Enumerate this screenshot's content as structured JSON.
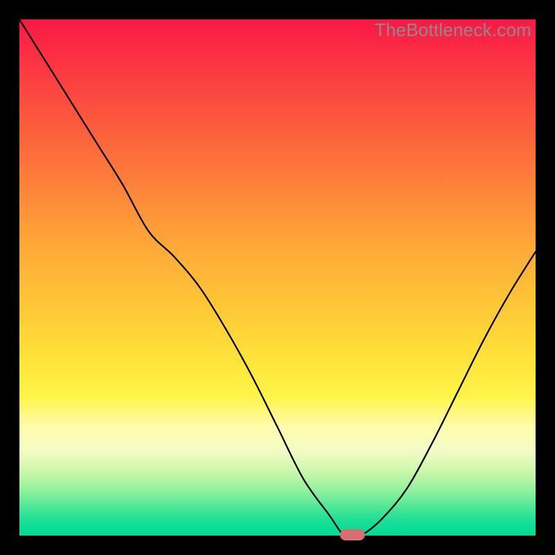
{
  "watermark": "TheBottleneck.com",
  "chart_data": {
    "type": "line",
    "x": [
      0.0,
      0.05,
      0.1,
      0.15,
      0.2,
      0.25,
      0.3,
      0.35,
      0.4,
      0.45,
      0.5,
      0.55,
      0.6,
      0.63,
      0.66,
      0.7,
      0.75,
      0.8,
      0.85,
      0.9,
      0.95,
      1.0
    ],
    "values": [
      1.0,
      0.92,
      0.84,
      0.76,
      0.68,
      0.59,
      0.54,
      0.48,
      0.4,
      0.31,
      0.21,
      0.11,
      0.04,
      0.0,
      0.0,
      0.03,
      0.09,
      0.18,
      0.28,
      0.38,
      0.47,
      0.55
    ],
    "title": "",
    "xlabel": "",
    "ylabel": "",
    "xlim": [
      0,
      1
    ],
    "ylim": [
      0,
      1
    ],
    "marker": {
      "x": 0.645,
      "y": 0.0
    },
    "background_gradient": [
      "#fa1846",
      "#fea938",
      "#fff448",
      "#00da95"
    ]
  }
}
